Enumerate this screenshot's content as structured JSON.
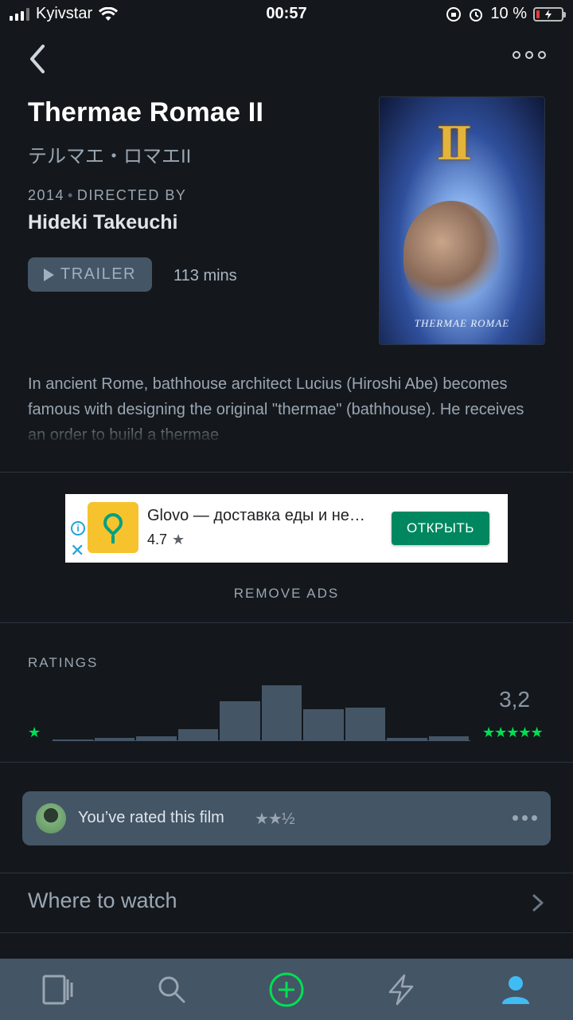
{
  "status_bar": {
    "carrier": "Kyivstar",
    "time": "00:57",
    "battery": "10 %"
  },
  "film": {
    "title": "Thermae Romae II",
    "original_title": "テルマエ・ロマエII",
    "year": "2014",
    "directed_by_label": "DIRECTED BY",
    "director": "Hideki Takeuchi",
    "trailer_label": "TRAILER",
    "runtime": "113 mins",
    "poster": {
      "numeral": "II",
      "caption": "THERMAE ROMAE"
    },
    "synopsis": "In ancient Rome, bathhouse architect Lucius (Hiroshi Abe) becomes famous with designing the original \"thermae\" (bathhouse). He receives an order to build a thermae"
  },
  "ad": {
    "app_name": "Glovo — доставка еды и не…",
    "rating": "4.7",
    "button_label": "ОТКРЫТЬ",
    "brand_color": "#f6c32e",
    "button_color": "#01875f"
  },
  "remove_ads_label": "REMOVE ADS",
  "ratings": {
    "label": "RATINGS",
    "average": "3,2",
    "min_star": "★",
    "max_stars": "★★★★★",
    "accent_color": "#00e054"
  },
  "chart_data": {
    "type": "bar",
    "categories": [
      "½",
      "1",
      "1½",
      "2",
      "2½",
      "3",
      "3½",
      "4",
      "4½",
      "5"
    ],
    "values": [
      2,
      4,
      6,
      15,
      50,
      70,
      40,
      42,
      4,
      6
    ]
  },
  "your_rating": {
    "text": "You’ve rated this film",
    "stars": "★★½"
  },
  "where_to_watch_label": "Where to watch",
  "tabbar": {
    "items": [
      {
        "icon": "films-icon",
        "active": false
      },
      {
        "icon": "search-icon",
        "active": false
      },
      {
        "icon": "add-icon",
        "active": false
      },
      {
        "icon": "activity-icon",
        "active": false
      },
      {
        "icon": "profile-icon",
        "active": true
      }
    ]
  }
}
